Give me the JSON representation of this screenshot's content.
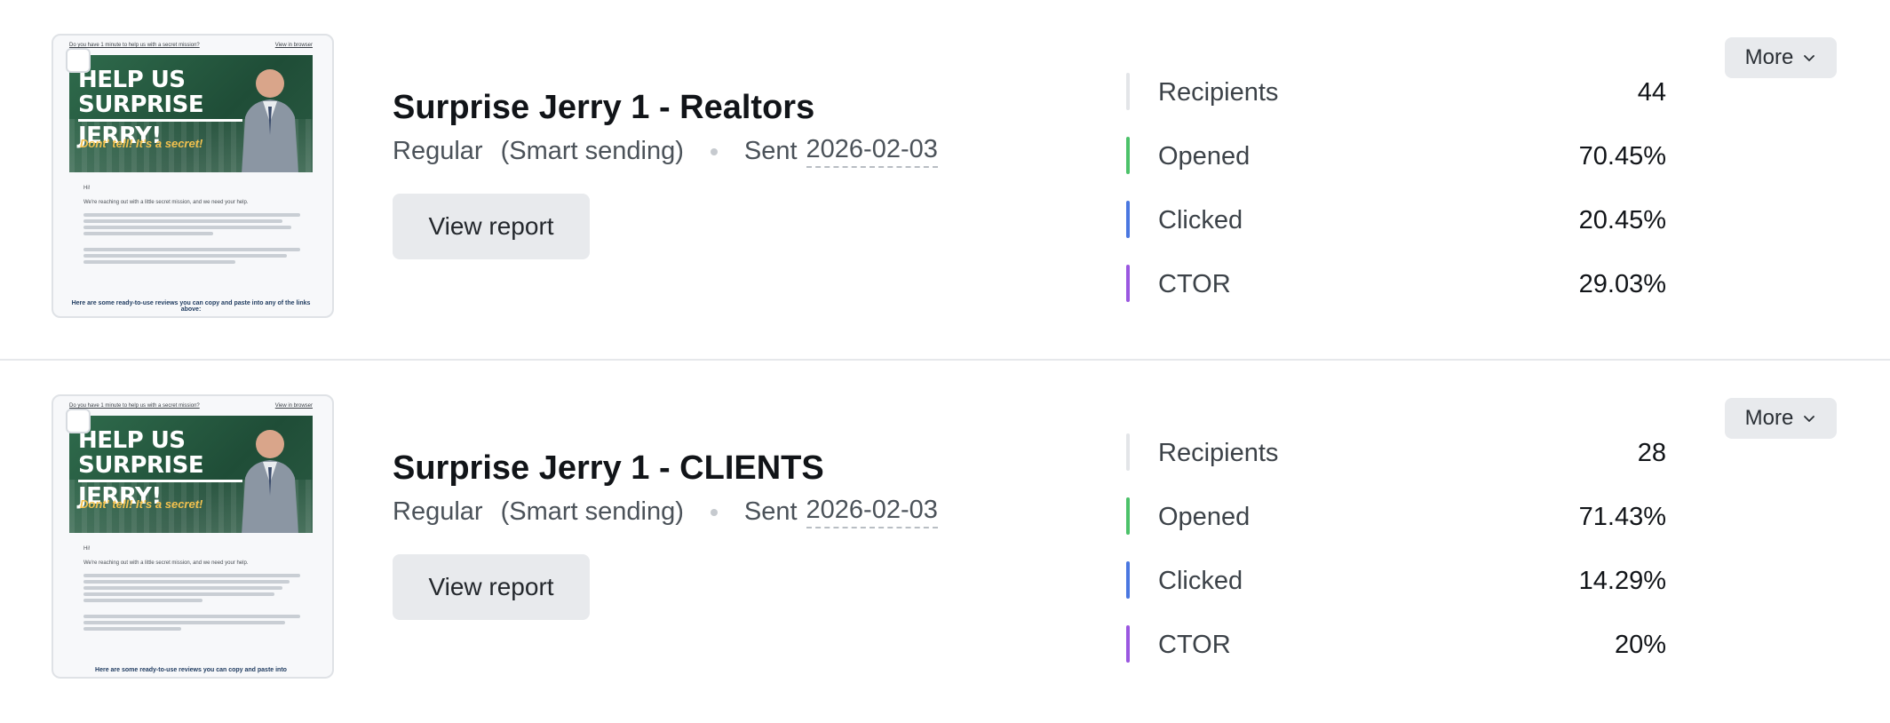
{
  "campaigns": [
    {
      "title": "Surprise Jerry 1 - Realtors",
      "type": "Regular",
      "mode": "(Smart sending)",
      "sent_label": "Sent",
      "sent_date": "2026-02-03",
      "view_report_label": "View report",
      "more_label": "More",
      "thumbnail": {
        "top_left": "Do you have 1 minute to help us with a secret mission?",
        "top_right": "View in browser",
        "hero_title_1": "HELP US SURPRISE",
        "hero_title_2": "JERRY!",
        "tagline": "Dont' tell! It's a secret!",
        "greeting": "Hi!",
        "body_1": "We're reaching out with a little secret mission, and we need your help.",
        "cta": "Here are some ready-to-use reviews you can copy and paste into any of the links above:"
      },
      "stats": [
        {
          "label": "Recipients",
          "value": "44",
          "color": "#e3e5e8"
        },
        {
          "label": "Opened",
          "value": "70.45%",
          "color": "#4cc26a"
        },
        {
          "label": "Clicked",
          "value": "20.45%",
          "color": "#4a77e0"
        },
        {
          "label": "CTOR",
          "value": "29.03%",
          "color": "#9a57e0"
        }
      ]
    },
    {
      "title": "Surprise Jerry 1 - CLIENTS",
      "type": "Regular",
      "mode": "(Smart sending)",
      "sent_label": "Sent",
      "sent_date": "2026-02-03",
      "view_report_label": "View report",
      "more_label": "More",
      "thumbnail": {
        "top_left": "Do you have 1 minute to help us with a secret mission?",
        "top_right": "View in browser",
        "hero_title_1": "HELP US SURPRISE",
        "hero_title_2": "JERRY!",
        "tagline": "Dont' tell! It's a secret!",
        "greeting": "Hi!",
        "body_1": "We're reaching out with a little secret mission, and we need your help.",
        "cta": "Here are some ready-to-use reviews you can copy and paste into"
      },
      "stats": [
        {
          "label": "Recipients",
          "value": "28",
          "color": "#e3e5e8"
        },
        {
          "label": "Opened",
          "value": "71.43%",
          "color": "#4cc26a"
        },
        {
          "label": "Clicked",
          "value": "14.29%",
          "color": "#4a77e0"
        },
        {
          "label": "CTOR",
          "value": "20%",
          "color": "#9a57e0"
        }
      ]
    }
  ]
}
